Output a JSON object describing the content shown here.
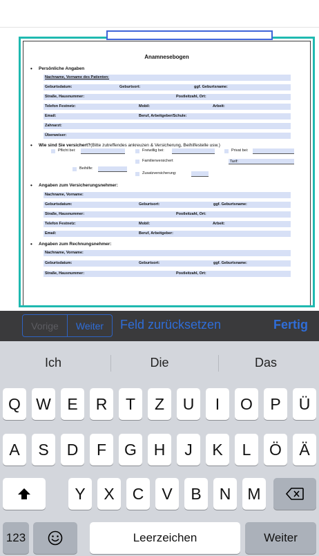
{
  "form": {
    "title": "Anamnesebogen",
    "sections": {
      "personal": "Persönliche Angaben",
      "insurance_q": "Wie sind Sie versichert?",
      "insurance_hint": "(Bitte zutreffendes ankreuzen & Versicherung, Beihilfestelle usw.)",
      "policyholder": "Angaben zum Versicherungsnehmer:",
      "invoice": "Angaben zum Rechnungsnehmer:"
    },
    "labels": {
      "patient_name": "Nachname, Vorname des Patienten:",
      "dob": "Geburtsdatum:",
      "birthplace": "Geburtsort:",
      "birthname": "ggf. Geburtsname:",
      "street": "Straße, Hausnummer:",
      "zip_city": "Postleitzahl, Ort:",
      "phone": "Telefon Festnetz:",
      "mobile": "Mobil:",
      "work": "Arbeit:",
      "email": "Email:",
      "job_school": "Beruf, Arbeitgeber/Schule:",
      "dentist": "Zahnarzt:",
      "referrer": "Überweiser:",
      "name": "Nachname, Vorname:",
      "job": "Beruf, Arbeitgeber:",
      "mandatory": "Pflicht bei:",
      "voluntary": "Freiwillig bei:",
      "private": "Privat bei:",
      "family": "Familienversichert",
      "tariff": "Tarif:",
      "subsidy": "Beihilfe:",
      "supplementary": "Zusatzversicherung:"
    }
  },
  "accessory": {
    "prev": "Vorige",
    "next": "Weiter",
    "reset": "Feld zurücksetzen",
    "done": "Fertig"
  },
  "keyboard": {
    "suggestions": [
      "Ich",
      "Die",
      "Das"
    ],
    "row1": [
      "Q",
      "W",
      "E",
      "R",
      "T",
      "Z",
      "U",
      "I",
      "O",
      "P",
      "Ü"
    ],
    "row2": [
      "A",
      "S",
      "D",
      "F",
      "G",
      "H",
      "J",
      "K",
      "L",
      "Ö",
      "Ä"
    ],
    "row3": [
      "Y",
      "X",
      "C",
      "V",
      "B",
      "N",
      "M"
    ],
    "numbers": "123",
    "space": "Leerzeichen",
    "return": "Weiter",
    "shift_icon": "shift-arrow-icon",
    "delete_icon": "backspace-icon",
    "emoji_icon": "emoji-smiley-icon"
  },
  "colors": {
    "frame": "#1fb9b0",
    "field": "#d7e0f6",
    "active_field": "#3e63d8",
    "accent": "#2f6dd8"
  }
}
